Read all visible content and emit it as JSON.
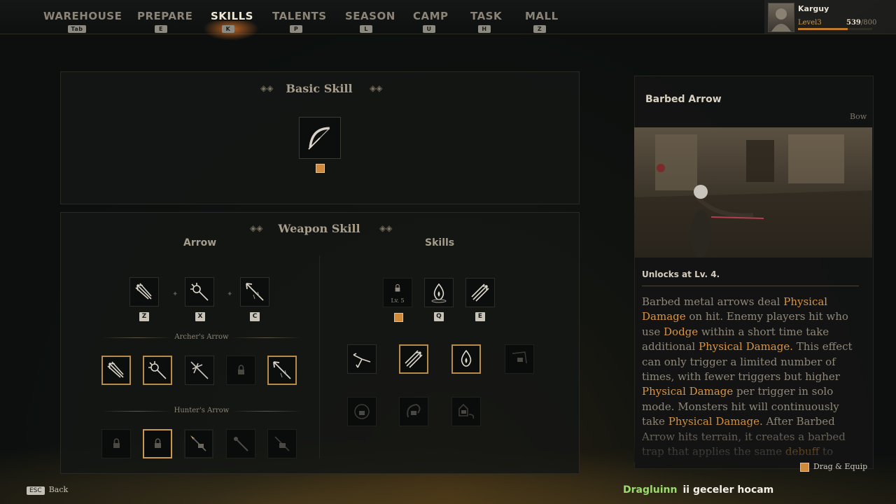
{
  "nav": [
    {
      "label": "WAREHOUSE",
      "key": "Tab"
    },
    {
      "label": "PREPARE",
      "key": "E"
    },
    {
      "label": "SKILLS",
      "key": "K"
    },
    {
      "label": "TALENTS",
      "key": "P"
    },
    {
      "label": "SEASON",
      "key": "L"
    },
    {
      "label": "CAMP",
      "key": "U"
    },
    {
      "label": "TASK",
      "key": "H"
    },
    {
      "label": "MALL",
      "key": "Z"
    }
  ],
  "user": {
    "name": "Karguy",
    "level": "Level3",
    "xp_current": "539",
    "xp_max": "/800",
    "xp_progress": 0.674
  },
  "basic_skill": {
    "title": "Basic Skill"
  },
  "weapon_skill": {
    "title": "Weapon Skill",
    "arrow_title": "Arrow",
    "skills_title": "Skills",
    "arrow_keys": [
      "Z",
      "X",
      "C"
    ],
    "skill_keys": [
      "Q",
      "E"
    ],
    "locked_slot_label": "Lv. 5",
    "archers_arrow": "Archer's Arrow",
    "hunters_arrow": "Hunter's Arrow"
  },
  "detail": {
    "title": "Barbed Arrow",
    "type": "Bow",
    "unlock": "Unlocks at Lv. 4.",
    "desc": [
      {
        "t": "Barbed metal arrows deal ",
        "h": false
      },
      {
        "t": "Physical Damage",
        "h": true
      },
      {
        "t": " on hit. Enemy players hit who use ",
        "h": false
      },
      {
        "t": "Dodge",
        "h": true
      },
      {
        "t": " within a short time take additional ",
        "h": false
      },
      {
        "t": "Physical Damage.",
        "h": true
      },
      {
        "t": " This effect can only trigger a limited number of times, with fewer triggers but higher ",
        "h": false
      },
      {
        "t": "Physical Damage",
        "h": true
      },
      {
        "t": " per trigger in solo mode. Monsters hit will continuously take ",
        "h": false
      },
      {
        "t": "Physical Damage.",
        "h": true
      },
      {
        "t": " After Barbed Arrow hits terrain, it creates a barbed trap that applies the same ",
        "h": false
      },
      {
        "t": "debuff",
        "h": true
      },
      {
        "t": " to enemies who",
        "h": false
      }
    ]
  },
  "footer": {
    "esc_key": "ESC",
    "back_label": "Back",
    "drag_label": "Drag & Equip"
  },
  "chat": {
    "name": "Dragluinn",
    "message": "ii geceler hocam"
  },
  "colors": {
    "accent": "#d9953f",
    "active_nav": "#f0e7d5",
    "chat_name": "#9bdc6e"
  }
}
